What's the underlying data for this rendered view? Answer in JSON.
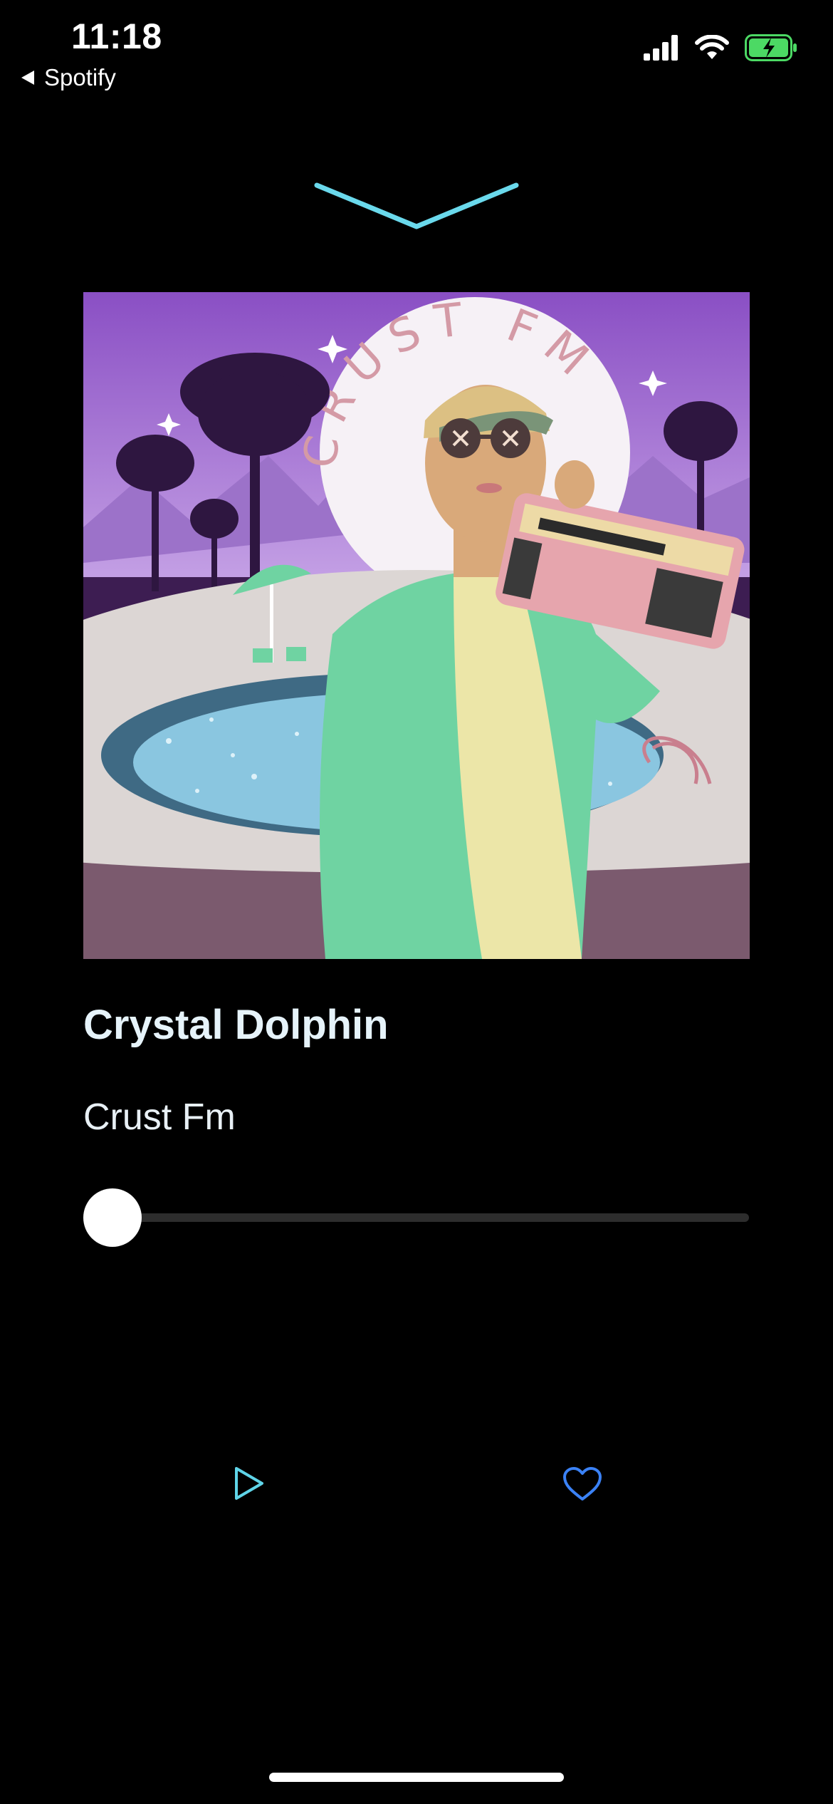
{
  "status_bar": {
    "time": "11:18",
    "back_label": "Spotify",
    "icons": [
      "signal-icon",
      "wifi-icon",
      "battery-charging-icon"
    ]
  },
  "album": {
    "art_text": "CRUST FM"
  },
  "track": {
    "title": "Crystal Dolphin",
    "artist": "Crust Fm"
  },
  "progress": {
    "value": 0
  },
  "controls": {
    "play_icon": "play-icon",
    "like_icon": "heart-icon"
  },
  "colors": {
    "background": "#000000",
    "accent_chevron": "#6ad9ec",
    "play_icon": "#5fd4e8",
    "heart_icon": "#3b82f6",
    "battery_fill": "#4cd964"
  }
}
